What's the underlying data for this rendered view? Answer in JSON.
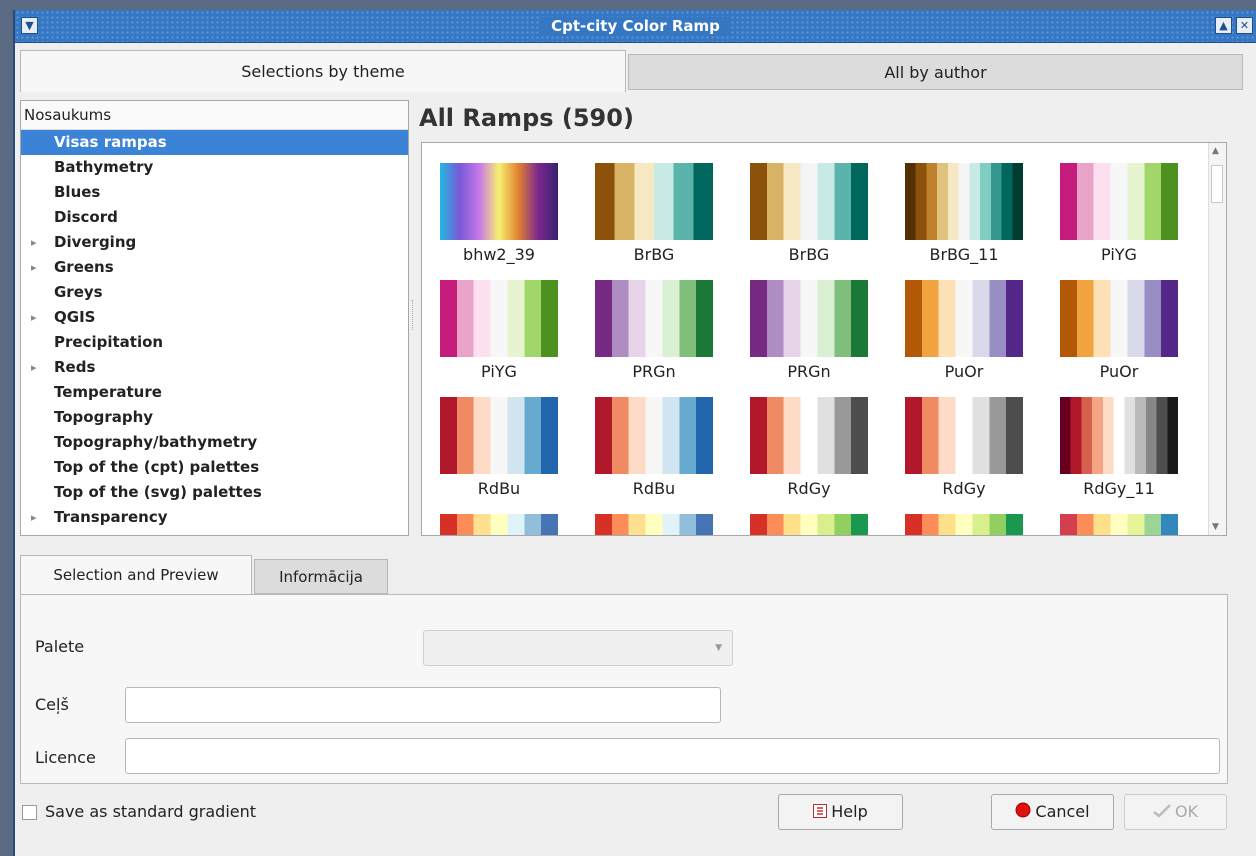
{
  "window": {
    "title": "Cpt-city Color Ramp"
  },
  "tabs": {
    "theme": "Selections by theme",
    "author": "All by author"
  },
  "tree": {
    "header": "Nosaukums",
    "items": [
      {
        "label": "Visas rampas",
        "selected": true,
        "expandable": false
      },
      {
        "label": "Bathymetry",
        "expandable": false
      },
      {
        "label": "Blues",
        "expandable": false
      },
      {
        "label": "Discord",
        "expandable": false
      },
      {
        "label": "Diverging",
        "expandable": true
      },
      {
        "label": "Greens",
        "expandable": true
      },
      {
        "label": "Greys",
        "expandable": false
      },
      {
        "label": "QGIS",
        "expandable": true
      },
      {
        "label": "Precipitation",
        "expandable": false
      },
      {
        "label": "Reds",
        "expandable": true
      },
      {
        "label": "Temperature",
        "expandable": false
      },
      {
        "label": "Topography",
        "expandable": false
      },
      {
        "label": "Topography/bathymetry",
        "expandable": false
      },
      {
        "label": "Top of the (cpt) palettes",
        "expandable": false
      },
      {
        "label": "Top of the (svg) palettes",
        "expandable": false
      },
      {
        "label": "Transparency",
        "expandable": true
      }
    ]
  },
  "ramps_heading": "All Ramps (590)",
  "ramps": [
    {
      "name": "bhw2_39",
      "gradient": true,
      "colors": [
        "#20b8e0",
        "#7a58d8",
        "#c678e8",
        "#f8f070",
        "#e08030",
        "#7a2890",
        "#3a2070"
      ]
    },
    {
      "name": "BrBG",
      "colors": [
        "#8c510a",
        "#d8b365",
        "#f6e8c3",
        "#c7eae5",
        "#5ab4ac",
        "#01665e"
      ]
    },
    {
      "name": "BrBG",
      "colors": [
        "#8c510a",
        "#d8b365",
        "#f6e8c3",
        "#f5f5f5",
        "#c7eae5",
        "#5ab4ac",
        "#01665e"
      ]
    },
    {
      "name": "BrBG_11",
      "colors": [
        "#543005",
        "#8c510a",
        "#bf812d",
        "#dfc27d",
        "#f6e8c3",
        "#f5f5f5",
        "#c7eae5",
        "#80cdc1",
        "#35978f",
        "#01665e",
        "#003c30"
      ]
    },
    {
      "name": "PiYG",
      "colors": [
        "#c51b7d",
        "#e9a3c9",
        "#fde0ef",
        "#f7f7f7",
        "#e6f5d0",
        "#a1d76a",
        "#4d9221"
      ]
    },
    {
      "name": "PiYG",
      "colors": [
        "#c51b7d",
        "#e9a3c9",
        "#fde0ef",
        "#f7f7f7",
        "#e6f5d0",
        "#a1d76a",
        "#4d9221"
      ]
    },
    {
      "name": "PRGn",
      "colors": [
        "#762a83",
        "#af8dc3",
        "#e7d4e8",
        "#f7f7f7",
        "#d9f0d3",
        "#7fbf7b",
        "#1b7837"
      ]
    },
    {
      "name": "PRGn",
      "colors": [
        "#762a83",
        "#af8dc3",
        "#e7d4e8",
        "#f7f7f7",
        "#d9f0d3",
        "#7fbf7b",
        "#1b7837"
      ]
    },
    {
      "name": "PuOr",
      "colors": [
        "#b35806",
        "#f1a340",
        "#fee0b6",
        "#f7f7f7",
        "#d8daeb",
        "#998ec3",
        "#542788"
      ]
    },
    {
      "name": "PuOr",
      "colors": [
        "#b35806",
        "#f1a340",
        "#fee0b6",
        "#f7f7f7",
        "#d8daeb",
        "#998ec3",
        "#542788"
      ]
    },
    {
      "name": "RdBu",
      "colors": [
        "#b2182b",
        "#ef8a62",
        "#fddbc7",
        "#f7f7f7",
        "#d1e5f0",
        "#67a9cf",
        "#2166ac"
      ]
    },
    {
      "name": "RdBu",
      "colors": [
        "#b2182b",
        "#ef8a62",
        "#fddbc7",
        "#f7f7f7",
        "#d1e5f0",
        "#67a9cf",
        "#2166ac"
      ]
    },
    {
      "name": "RdGy",
      "colors": [
        "#b2182b",
        "#ef8a62",
        "#fddbc7",
        "#ffffff",
        "#e0e0e0",
        "#999999",
        "#4d4d4d"
      ]
    },
    {
      "name": "RdGy",
      "colors": [
        "#b2182b",
        "#ef8a62",
        "#fddbc7",
        "#ffffff",
        "#e0e0e0",
        "#999999",
        "#4d4d4d"
      ]
    },
    {
      "name": "RdGy_11",
      "colors": [
        "#67001f",
        "#b2182b",
        "#d6604d",
        "#f4a582",
        "#fddbc7",
        "#ffffff",
        "#e0e0e0",
        "#bababa",
        "#878787",
        "#4d4d4d",
        "#1a1a1a"
      ]
    },
    {
      "name": "",
      "colors": [
        "#d73027",
        "#fc8d59",
        "#fee090",
        "#ffffbf",
        "#e0f3f8",
        "#91bfdb",
        "#4575b4"
      ]
    },
    {
      "name": "",
      "colors": [
        "#d73027",
        "#fc8d59",
        "#fee090",
        "#ffffbf",
        "#e0f3f8",
        "#91bfdb",
        "#4575b4"
      ]
    },
    {
      "name": "",
      "colors": [
        "#d73027",
        "#fc8d59",
        "#fee08b",
        "#ffffbf",
        "#d9ef8b",
        "#91cf60",
        "#1a9850"
      ]
    },
    {
      "name": "",
      "colors": [
        "#d73027",
        "#fc8d59",
        "#fee08b",
        "#ffffbf",
        "#d9ef8b",
        "#91cf60",
        "#1a9850"
      ]
    },
    {
      "name": "",
      "colors": [
        "#d53e4f",
        "#fc8d59",
        "#fee08b",
        "#ffffbf",
        "#e6f598",
        "#99d594",
        "#3288bd"
      ]
    }
  ],
  "subtabs": {
    "preview": "Selection and Preview",
    "info": "Informācija"
  },
  "form": {
    "palette_label": "Palete",
    "palette_value": "",
    "path_label": "Ceļš",
    "path_value": "",
    "license_label": "Licence",
    "license_value": ""
  },
  "footer": {
    "save_label": "Save as standard gradient",
    "save_checked": false,
    "help_label": "Help",
    "cancel_label": "Cancel",
    "ok_label": "OK"
  }
}
